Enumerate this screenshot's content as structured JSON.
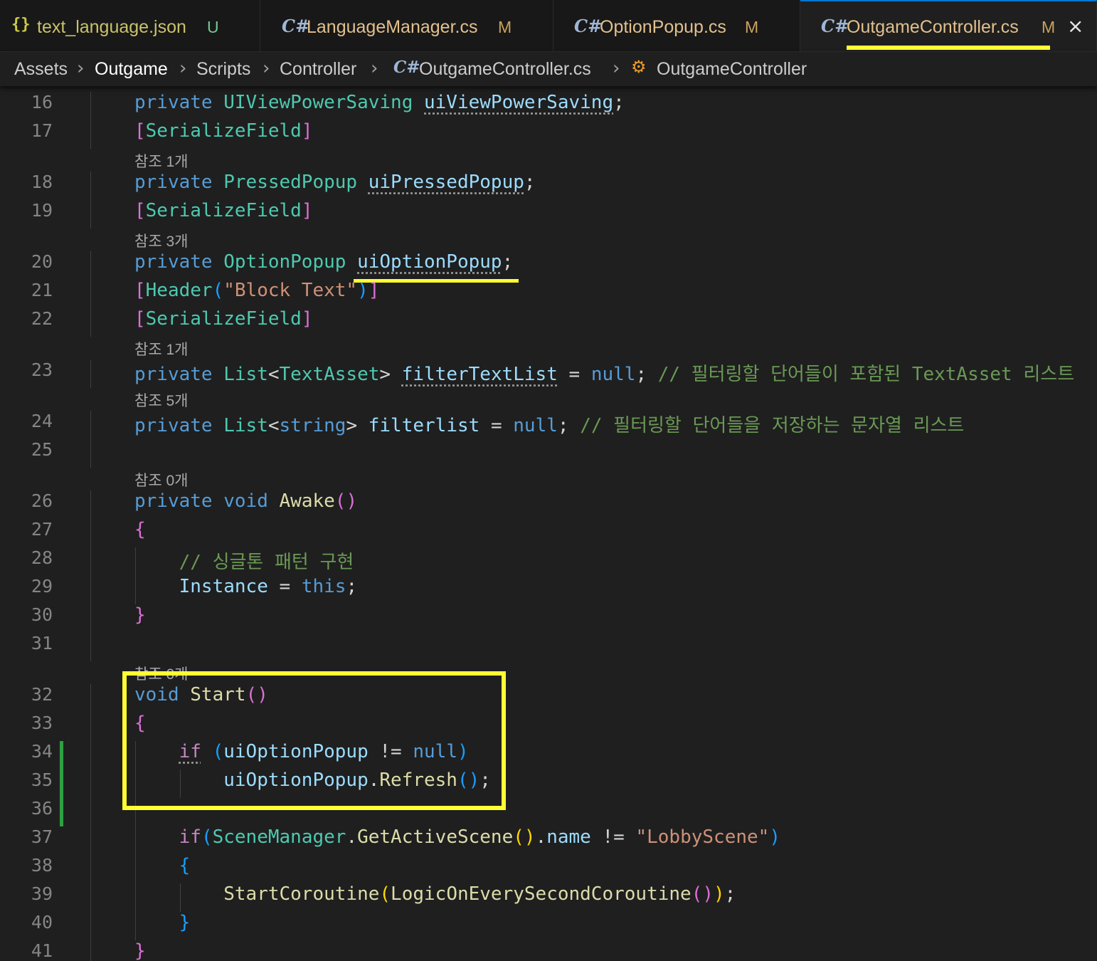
{
  "tabs": [
    {
      "icon": "{}",
      "label": "text_language.json",
      "status": "U"
    },
    {
      "icon": "C#",
      "label": "LanguageManager.cs",
      "status": "M"
    },
    {
      "icon": "C#",
      "label": "OptionPopup.cs",
      "status": "M"
    },
    {
      "icon": "C#",
      "label": "OutgameController.cs",
      "status": "M",
      "active": true
    }
  ],
  "close_glyph": "×",
  "breadcrumb": {
    "items": [
      "Assets",
      "Outgame",
      "Scripts",
      "Controller",
      "OutgameController.cs",
      "OutgameController"
    ],
    "sep": "›"
  },
  "code": {
    "lenses": [
      "참조 1개",
      "참조 3개",
      "참조 1개",
      "참조 5개",
      "참조 0개",
      "참조 0개"
    ],
    "line_numbers": [
      "16",
      "17",
      "18",
      "19",
      "20",
      "21",
      "22",
      "23",
      "24",
      "25",
      "26",
      "27",
      "28",
      "29",
      "30",
      "31",
      "32",
      "33",
      "34",
      "35",
      "36",
      "37",
      "38",
      "39",
      "40",
      "41"
    ],
    "tokens": {
      "private": "private",
      "void": "void",
      "this": "this",
      "null": "null",
      "if": "if",
      "string": "string",
      "UIViewPowerSaving": "UIViewPowerSaving",
      "uiViewPowerSaving": "uiViewPowerSaving",
      "SerializeField": "SerializeField",
      "PressedPopup": "PressedPopup",
      "uiPressedPopup": "uiPressedPopup",
      "OptionPopup": "OptionPopup",
      "uiOptionPopup": "uiOptionPopup",
      "Header": "Header",
      "block_text": "\"Block Text\"",
      "List": "List",
      "TextAsset": "TextAsset",
      "filterTextList": "filterTextList",
      "filterlist": "filterlist",
      "comment_23": "// 필터링할 단어들이 포함된 TextAsset 리스트",
      "comment_24": "// 필터링할 단어들을 저장하는 문자열 리스트",
      "Awake": "Awake",
      "comment_28": "// 싱글톤 패턴 구현",
      "Instance": "Instance",
      "Start": "Start",
      "Refresh": "Refresh",
      "SceneManager": "SceneManager",
      "GetActiveScene": "GetActiveScene",
      "name": "name",
      "lobby_scene": "\"LobbyScene\"",
      "StartCoroutine": "StartCoroutine",
      "LogicOnEverySecondCoroutine": "LogicOnEverySecondCoroutine"
    }
  }
}
